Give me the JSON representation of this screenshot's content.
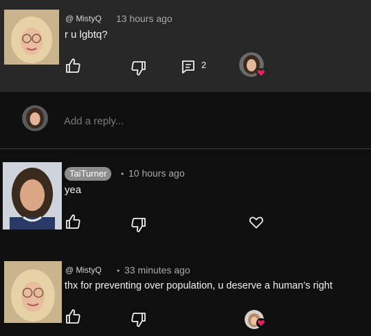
{
  "comments": [
    {
      "handle": "@ MistyQ",
      "time": "13 hours ago",
      "text": "r u lgbtq?",
      "reply_count": "2"
    },
    {
      "handle": "TaiTurner",
      "separator": "•",
      "time": "10 hours ago",
      "text": "yea"
    },
    {
      "handle": "@ MistyQ",
      "separator": "•",
      "time": "33 minutes ago",
      "text": "thx for preventing over population, u deserve a human’s right"
    }
  ],
  "reply": {
    "placeholder": "Add a reply..."
  },
  "colors": {
    "highlight_bg": "#272727",
    "page_bg": "#0f0f0f",
    "heart_red": "#e0245e",
    "pill_bg": "#8c8c8c"
  },
  "icons": [
    "like-icon",
    "dislike-icon",
    "reply-icon",
    "heart-icon",
    "creator-heart-badge"
  ]
}
